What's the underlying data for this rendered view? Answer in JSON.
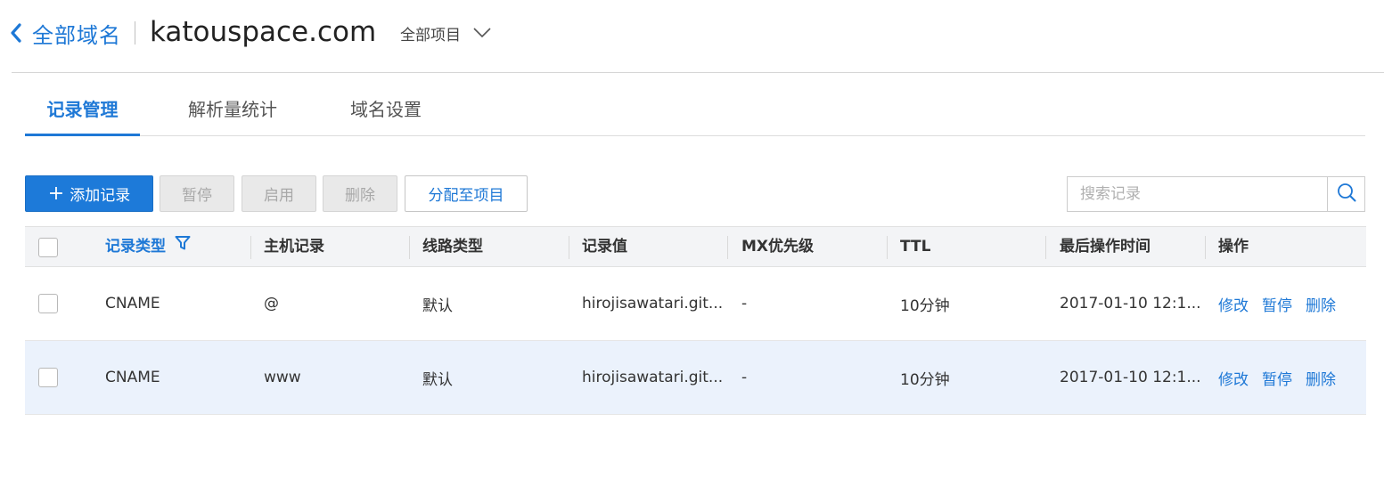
{
  "header": {
    "back_label": "全部域名",
    "domain": "katouspace.com",
    "project_select": "全部项目"
  },
  "tabs": [
    {
      "label": "记录管理",
      "active": true
    },
    {
      "label": "解析量统计",
      "active": false
    },
    {
      "label": "域名设置",
      "active": false
    }
  ],
  "toolbar": {
    "add_label": "添加记录",
    "pause_label": "暂停",
    "enable_label": "启用",
    "delete_label": "删除",
    "assign_label": "分配至项目"
  },
  "search": {
    "placeholder": "搜索记录",
    "value": ""
  },
  "table": {
    "columns": [
      "记录类型",
      "主机记录",
      "线路类型",
      "记录值",
      "MX优先级",
      "TTL",
      "最后操作时间",
      "操作"
    ],
    "rows": [
      {
        "type": "CNAME",
        "host": "@",
        "line": "默认",
        "value": "hirojisawatari.git...",
        "mx": "-",
        "ttl": "10分钟",
        "updated": "2017-01-10 12:1...",
        "actions": [
          "修改",
          "暂停",
          "删除"
        ]
      },
      {
        "type": "CNAME",
        "host": "www",
        "line": "默认",
        "value": "hirojisawatari.git...",
        "mx": "-",
        "ttl": "10分钟",
        "updated": "2017-01-10 12:1...",
        "actions": [
          "修改",
          "暂停",
          "删除"
        ]
      }
    ]
  },
  "colors": {
    "accent": "#1e78d6",
    "primary_button": "#1d7ad9",
    "header_row_bg": "#f3f4f6",
    "highlight_row_bg": "#ebf2fc"
  }
}
